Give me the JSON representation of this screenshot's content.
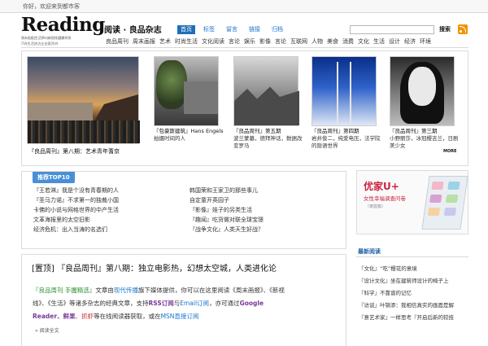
{
  "topbar": {
    "greeting": "你好，欢迎来到都市客"
  },
  "brand": {
    "logo": "Reading",
    "cn": "阅读 · 良品杂志",
    "tagline_1": "周末画报|生活|file|新视线|健康时尚",
    "tagline_2": "汽车生活|东方企业家|号外"
  },
  "mainnav": [
    "首页",
    "标签",
    "留言",
    "链接",
    "归档"
  ],
  "search": {
    "placeholder": "",
    "button": "搜索"
  },
  "subnav": [
    "良品周刊",
    "周末画报",
    "艺术",
    "时尚生活",
    "文化阅读",
    "言论",
    "娱乐",
    "影像",
    "言论",
    "互联网",
    "人物",
    "美食",
    "消费",
    "文化",
    "生活",
    "设计",
    "经济",
    "环境"
  ],
  "feature": {
    "caption": "『良品周刊』第八期：艺术青年蓍京"
  },
  "thumbs": [
    {
      "title": "『包豪斯建筑』Hans Engels",
      "desc": "拍摄时间的人"
    },
    {
      "title": "『良品周刊』第五期",
      "desc": "波兰蒙墓，德拜神话，数据改变罗马"
    },
    {
      "title": "『良品周刊』第四期",
      "desc": "岩井俊二，纯爱电压，法学院的隐语世界"
    },
    {
      "title": "『良品周刊』第三期",
      "desc": "小野丽莎，冰冠樱吉兰，日剧美少女"
    }
  ],
  "more_label": "MORE",
  "top10": {
    "title": "推荐TOP10",
    "left": [
      "『王若淋』我是个没有青春期的人",
      "『圣马力诺』不求第一的独裁小国",
      "卡佛的小说与网格世界的中产生活",
      "文革海报里的太空旧影",
      "经济危机：出入当涛的名选们"
    ],
    "right": [
      "韩国荣和王家卫的那些事儿",
      "自定童开英园子",
      "『影像』娃子的另类生活",
      "『趣闻』吃货做对联全球宝璟",
      "『战争文化』人类天生好战？"
    ]
  },
  "ad": {
    "brand": "优家U+",
    "line": "女性幸福调查问卷",
    "sub": "（家庭篇）"
  },
  "recent": {
    "title": "最新阅读",
    "items": [
      "『文化』“吃”樱花的意境",
      "『设计文化』坐在建筑师设计的椅子上",
      "『科学』不靠谱的记忆",
      "『访谈』叶锦添：我相信真实的画面是解",
      "『意艺术家』一样思考『开启后新的较技"
    ]
  },
  "article": {
    "title": "[置顶] 『良品周刊』第八期：独立电影热，幻想太空城，人类进化论",
    "line1_a": "『良品周刊 手握精选』",
    "line1_b": "文章由",
    "line1_c": "现代传播",
    "line1_d": "旗下媒体提供，你可以在这里阅读《周末画报》、《新视",
    "line2_a": "线》、《生活》等诸多杂志的经典文章，支持",
    "line2_b": "RSS订阅",
    "line2_c": "与",
    "line2_d": "Email订阅",
    "line2_e": "，亦可通过",
    "line2_f": "Google",
    "line3_a": "Reader",
    "line3_b": "、鲜果",
    "line3_c": "、抓虾",
    "line3_d": "等在线阅读器获取，或在",
    "line3_e": "MSN直接订阅",
    "more": "» 阅读全文"
  }
}
